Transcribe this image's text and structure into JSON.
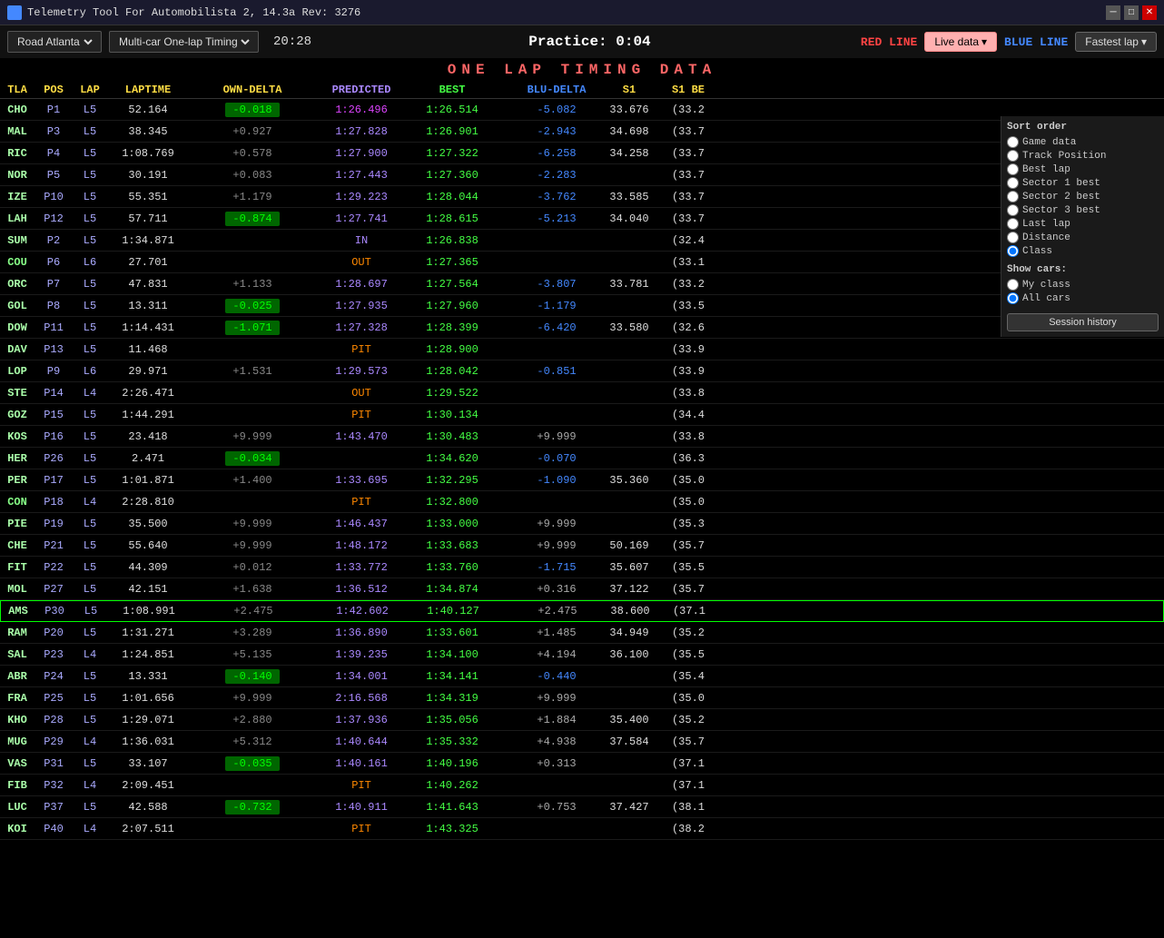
{
  "titlebar": {
    "title": "Telemetry Tool For Automobilista 2, 14.3a Rev: 3276",
    "icon": "app-icon"
  },
  "topbar": {
    "track": "Road Atlanta",
    "mode": "Multi-car  One-lap Timing",
    "time": "20:28",
    "session": "Practice: 0:04",
    "red_line": "RED LINE",
    "blue_line": "BLUE LINE",
    "live_data": "Live data",
    "fastest_lap": "Fastest lap"
  },
  "header": "ONE LAP TIMING DATA",
  "columns": {
    "tla": "TLA",
    "pos": "POS",
    "lap": "LAP",
    "laptime": "LAPTIME",
    "owndelta": "OWN-DELTA",
    "predicted": "PREDICTED",
    "best": "BEST",
    "bludelta": "BLU-DELTA",
    "s1": "S1",
    "s1b": "S1 BE"
  },
  "sort_order": {
    "label": "Sort order",
    "options": [
      "Game data",
      "Track Position",
      "Best lap",
      "Sector 1 best",
      "Sector 2 best",
      "Sector 3 best",
      "Last lap",
      "Distance",
      "Class"
    ],
    "selected": "Class"
  },
  "show_cars": {
    "label": "Show cars:",
    "options": [
      "My class",
      "All cars"
    ],
    "selected": "All cars"
  },
  "session_history_btn": "Session history",
  "rows": [
    {
      "tla": "CHO",
      "pos": "P1",
      "lap": "L5",
      "laptime": "52.164",
      "owndelta": "-0.018",
      "owndelta_type": "green",
      "predicted": "1:26.496",
      "predicted_type": "purple",
      "best": "1:26.514",
      "best_type": "green",
      "bludelta": "-5.082",
      "s1": "33.676",
      "s1b": "(33.2",
      "highlight": false
    },
    {
      "tla": "MAL",
      "pos": "P3",
      "lap": "L5",
      "laptime": "38.345",
      "owndelta": "+0.927",
      "owndelta_type": "dim",
      "predicted": "1:27.828",
      "predicted_type": "normal",
      "best": "1:26.901",
      "best_type": "normal",
      "bludelta": "-2.943",
      "s1": "34.698",
      "s1b": "(33.7",
      "highlight": false
    },
    {
      "tla": "RIC",
      "pos": "P4",
      "lap": "L5",
      "laptime": "1:08.769",
      "owndelta": "+0.578",
      "owndelta_type": "dim",
      "predicted": "1:27.900",
      "predicted_type": "normal",
      "best": "1:27.322",
      "best_type": "normal",
      "bludelta": "-6.258",
      "s1": "34.258",
      "s1b": "(33.7",
      "highlight": false
    },
    {
      "tla": "NOR",
      "pos": "P5",
      "lap": "L5",
      "laptime": "30.191",
      "owndelta": "+0.083",
      "owndelta_type": "dim",
      "predicted": "1:27.443",
      "predicted_type": "normal",
      "best": "1:27.360",
      "best_type": "normal",
      "bludelta": "-2.283",
      "s1": "",
      "s1b": "(33.7",
      "highlight": false
    },
    {
      "tla": "IZE",
      "pos": "P10",
      "lap": "L5",
      "laptime": "55.351",
      "owndelta": "+1.179",
      "owndelta_type": "dim",
      "predicted": "1:29.223",
      "predicted_type": "normal",
      "best": "1:28.044",
      "best_type": "normal",
      "bludelta": "-3.762",
      "s1": "33.585",
      "s1b": "(33.7",
      "highlight": false
    },
    {
      "tla": "LAH",
      "pos": "P12",
      "lap": "L5",
      "laptime": "57.711",
      "owndelta": "-0.874",
      "owndelta_type": "green",
      "predicted": "1:27.741",
      "predicted_type": "normal",
      "best": "1:28.615",
      "best_type": "normal",
      "bludelta": "-5.213",
      "s1": "34.040",
      "s1b": "(33.7",
      "highlight": false
    },
    {
      "tla": "SUM",
      "pos": "P2",
      "lap": "L5",
      "laptime": "1:34.871",
      "owndelta": "",
      "owndelta_type": "none",
      "predicted": "IN",
      "predicted_type": "special_in",
      "best": "1:26.838",
      "best_type": "normal",
      "bludelta": "",
      "s1": "",
      "s1b": "(32.4",
      "highlight": false
    },
    {
      "tla": "COU",
      "pos": "P6",
      "lap": "L6",
      "laptime": "27.701",
      "owndelta": "",
      "owndelta_type": "none",
      "predicted": "OUT",
      "predicted_type": "special_out",
      "best": "1:27.365",
      "best_type": "normal",
      "bludelta": "",
      "s1": "",
      "s1b": "(33.1",
      "highlight": false
    },
    {
      "tla": "ORC",
      "pos": "P7",
      "lap": "L5",
      "laptime": "47.831",
      "owndelta": "+1.133",
      "owndelta_type": "dim",
      "predicted": "1:28.697",
      "predicted_type": "normal",
      "best": "1:27.564",
      "best_type": "normal",
      "bludelta": "-3.807",
      "s1": "33.781",
      "s1b": "(33.2",
      "highlight": false
    },
    {
      "tla": "GOL",
      "pos": "P8",
      "lap": "L5",
      "laptime": "13.311",
      "owndelta": "-0.025",
      "owndelta_type": "green",
      "predicted": "1:27.935",
      "predicted_type": "normal",
      "best": "1:27.960",
      "best_type": "normal",
      "bludelta": "-1.179",
      "s1": "",
      "s1b": "(33.5",
      "highlight": false
    },
    {
      "tla": "DOW",
      "pos": "P11",
      "lap": "L5",
      "laptime": "1:14.431",
      "owndelta": "-1.071",
      "owndelta_type": "green",
      "predicted": "1:27.328",
      "predicted_type": "normal",
      "best": "1:28.399",
      "best_type": "normal",
      "bludelta": "-6.420",
      "s1": "33.580",
      "s1b": "(32.6",
      "highlight": false
    },
    {
      "tla": "DAV",
      "pos": "P13",
      "lap": "L5",
      "laptime": "11.468",
      "owndelta": "",
      "owndelta_type": "none",
      "predicted": "PIT",
      "predicted_type": "special_pit",
      "best": "1:28.900",
      "best_type": "normal",
      "bludelta": "",
      "s1": "",
      "s1b": "(33.9",
      "highlight": false
    },
    {
      "tla": "LOP",
      "pos": "P9",
      "lap": "L6",
      "laptime": "29.971",
      "owndelta": "+1.531",
      "owndelta_type": "dim",
      "predicted": "1:29.573",
      "predicted_type": "normal",
      "best": "1:28.042",
      "best_type": "normal",
      "bludelta": "-0.851",
      "s1": "",
      "s1b": "(33.9",
      "highlight": false
    },
    {
      "tla": "STE",
      "pos": "P14",
      "lap": "L4",
      "laptime": "2:26.471",
      "owndelta": "",
      "owndelta_type": "none",
      "predicted": "OUT",
      "predicted_type": "special_out",
      "best": "1:29.522",
      "best_type": "normal",
      "bludelta": "",
      "s1": "",
      "s1b": "(33.8",
      "highlight": false
    },
    {
      "tla": "GOZ",
      "pos": "P15",
      "lap": "L5",
      "laptime": "1:44.291",
      "owndelta": "",
      "owndelta_type": "none",
      "predicted": "PIT",
      "predicted_type": "special_pit",
      "best": "1:30.134",
      "best_type": "normal",
      "bludelta": "",
      "s1": "",
      "s1b": "(34.4",
      "highlight": false
    },
    {
      "tla": "KOS",
      "pos": "P16",
      "lap": "L5",
      "laptime": "23.418",
      "owndelta": "+9.999",
      "owndelta_type": "dim",
      "predicted": "1:43.470",
      "predicted_type": "normal",
      "best": "1:30.483",
      "best_type": "normal",
      "bludelta": "+9.999",
      "s1": "",
      "s1b": "(33.8",
      "highlight": false
    },
    {
      "tla": "HER",
      "pos": "P26",
      "lap": "L5",
      "laptime": "2.471",
      "owndelta": "-0.034",
      "owndelta_type": "green",
      "predicted": "",
      "predicted_type": "none",
      "best": "1:34.620",
      "best_type": "normal",
      "bludelta": "-0.070",
      "s1": "",
      "s1b": "(36.3",
      "highlight": false
    },
    {
      "tla": "PER",
      "pos": "P17",
      "lap": "L5",
      "laptime": "1:01.871",
      "owndelta": "+1.400",
      "owndelta_type": "dim",
      "predicted": "1:33.695",
      "predicted_type": "normal",
      "best": "1:32.295",
      "best_type": "normal",
      "bludelta": "-1.090",
      "s1": "35.360",
      "s1b": "(35.0",
      "highlight": false
    },
    {
      "tla": "CON",
      "pos": "P18",
      "lap": "L4",
      "laptime": "2:28.810",
      "owndelta": "",
      "owndelta_type": "none",
      "predicted": "PIT",
      "predicted_type": "special_pit",
      "best": "1:32.800",
      "best_type": "normal",
      "bludelta": "",
      "s1": "",
      "s1b": "(35.0",
      "highlight": false
    },
    {
      "tla": "PIE",
      "pos": "P19",
      "lap": "L5",
      "laptime": "35.500",
      "owndelta": "+9.999",
      "owndelta_type": "dim",
      "predicted": "1:46.437",
      "predicted_type": "normal",
      "best": "1:33.000",
      "best_type": "normal",
      "bludelta": "+9.999",
      "s1": "",
      "s1b": "(35.3",
      "highlight": false
    },
    {
      "tla": "CHE",
      "pos": "P21",
      "lap": "L5",
      "laptime": "55.640",
      "owndelta": "+9.999",
      "owndelta_type": "dim",
      "predicted": "1:48.172",
      "predicted_type": "normal",
      "best": "1:33.683",
      "best_type": "normal",
      "bludelta": "+9.999",
      "s1": "50.169",
      "s1b": "(35.7",
      "highlight": false
    },
    {
      "tla": "FIT",
      "pos": "P22",
      "lap": "L5",
      "laptime": "44.309",
      "owndelta": "+0.012",
      "owndelta_type": "dim",
      "predicted": "1:33.772",
      "predicted_type": "normal",
      "best": "1:33.760",
      "best_type": "normal",
      "bludelta": "-1.715",
      "s1": "35.607",
      "s1b": "(35.5",
      "highlight": false
    },
    {
      "tla": "MOL",
      "pos": "P27",
      "lap": "L5",
      "laptime": "42.151",
      "owndelta": "+1.638",
      "owndelta_type": "dim",
      "predicted": "1:36.512",
      "predicted_type": "normal",
      "best": "1:34.874",
      "best_type": "normal",
      "bludelta": "+0.316",
      "s1": "37.122",
      "s1b": "(35.7",
      "highlight": false
    },
    {
      "tla": "AMS",
      "pos": "P30",
      "lap": "L5",
      "laptime": "1:08.991",
      "owndelta": "+2.475",
      "owndelta_type": "dim",
      "predicted": "1:42.602",
      "predicted_type": "normal",
      "best": "1:40.127",
      "best_type": "normal",
      "bludelta": "+2.475",
      "s1": "38.600",
      "s1b": "(37.1",
      "highlight": true
    },
    {
      "tla": "RAM",
      "pos": "P20",
      "lap": "L5",
      "laptime": "1:31.271",
      "owndelta": "+3.289",
      "owndelta_type": "dim",
      "predicted": "1:36.890",
      "predicted_type": "normal",
      "best": "1:33.601",
      "best_type": "normal",
      "bludelta": "+1.485",
      "s1": "34.949",
      "s1b": "(35.2",
      "highlight": false
    },
    {
      "tla": "SAL",
      "pos": "P23",
      "lap": "L4",
      "laptime": "1:24.851",
      "owndelta": "+5.135",
      "owndelta_type": "dim",
      "predicted": "1:39.235",
      "predicted_type": "normal",
      "best": "1:34.100",
      "best_type": "normal",
      "bludelta": "+4.194",
      "s1": "36.100",
      "s1b": "(35.5",
      "highlight": false
    },
    {
      "tla": "ABR",
      "pos": "P24",
      "lap": "L5",
      "laptime": "13.331",
      "owndelta": "-0.140",
      "owndelta_type": "green",
      "predicted": "1:34.001",
      "predicted_type": "normal",
      "best": "1:34.141",
      "best_type": "normal",
      "bludelta": "-0.440",
      "s1": "",
      "s1b": "(35.4",
      "highlight": false
    },
    {
      "tla": "FRA",
      "pos": "P25",
      "lap": "L5",
      "laptime": "1:01.656",
      "owndelta": "+9.999",
      "owndelta_type": "dim",
      "predicted": "2:16.568",
      "predicted_type": "normal",
      "best": "1:34.319",
      "best_type": "normal",
      "bludelta": "+9.999",
      "s1": "",
      "s1b": "(35.0",
      "highlight": false
    },
    {
      "tla": "KHO",
      "pos": "P28",
      "lap": "L5",
      "laptime": "1:29.071",
      "owndelta": "+2.880",
      "owndelta_type": "dim",
      "predicted": "1:37.936",
      "predicted_type": "normal",
      "best": "1:35.056",
      "best_type": "normal",
      "bludelta": "+1.884",
      "s1": "35.400",
      "s1b": "(35.2",
      "highlight": false
    },
    {
      "tla": "MUG",
      "pos": "P29",
      "lap": "L4",
      "laptime": "1:36.031",
      "owndelta": "+5.312",
      "owndelta_type": "dim",
      "predicted": "1:40.644",
      "predicted_type": "normal",
      "best": "1:35.332",
      "best_type": "normal",
      "bludelta": "+4.938",
      "s1": "37.584",
      "s1b": "(35.7",
      "highlight": false
    },
    {
      "tla": "VAS",
      "pos": "P31",
      "lap": "L5",
      "laptime": "33.107",
      "owndelta": "-0.035",
      "owndelta_type": "green",
      "predicted": "1:40.161",
      "predicted_type": "normal",
      "best": "1:40.196",
      "best_type": "normal",
      "bludelta": "+0.313",
      "s1": "",
      "s1b": "(37.1",
      "highlight": false
    },
    {
      "tla": "FIB",
      "pos": "P32",
      "lap": "L4",
      "laptime": "2:09.451",
      "owndelta": "",
      "owndelta_type": "none",
      "predicted": "PIT",
      "predicted_type": "special_pit",
      "best": "1:40.262",
      "best_type": "normal",
      "bludelta": "",
      "s1": "",
      "s1b": "(37.1",
      "highlight": false
    },
    {
      "tla": "LUC",
      "pos": "P37",
      "lap": "L5",
      "laptime": "42.588",
      "owndelta": "-0.732",
      "owndelta_type": "green",
      "predicted": "1:40.911",
      "predicted_type": "normal",
      "best": "1:41.643",
      "best_type": "normal",
      "bludelta": "+0.753",
      "s1": "37.427",
      "s1b": "(38.1",
      "highlight": false
    },
    {
      "tla": "KOI",
      "pos": "P40",
      "lap": "L4",
      "laptime": "2:07.511",
      "owndelta": "",
      "owndelta_type": "none",
      "predicted": "PIT",
      "predicted_type": "special_pit",
      "best": "1:43.325",
      "best_type": "normal",
      "bludelta": "",
      "s1": "",
      "s1b": "(38.2",
      "highlight": false
    }
  ]
}
